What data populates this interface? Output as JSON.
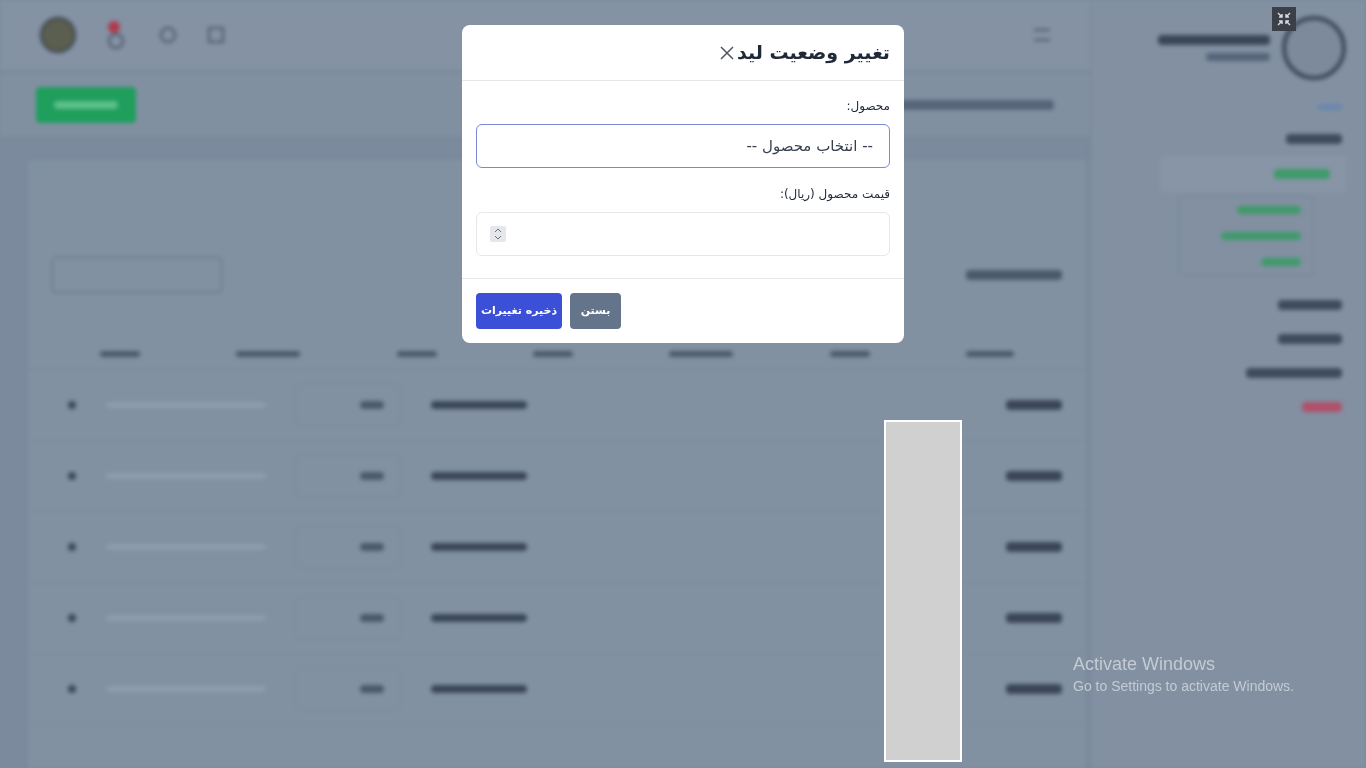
{
  "modal": {
    "title": "تغییر وضعیت لید",
    "fields": [
      {
        "kind": "select",
        "label": "محصول:",
        "value": "-- انتخاب محصول --",
        "focused": true
      },
      {
        "kind": "number",
        "label": "قیمت محصول (ریال):",
        "focused": false
      }
    ],
    "buttons": [
      {
        "kind": "secondary",
        "label": "بستن"
      },
      {
        "kind": "primary",
        "label": "ذخیره تغییرات"
      }
    ]
  },
  "os_notice": {
    "title": "Activate Windows",
    "subtitle": "Go to Settings to activate Windows."
  }
}
